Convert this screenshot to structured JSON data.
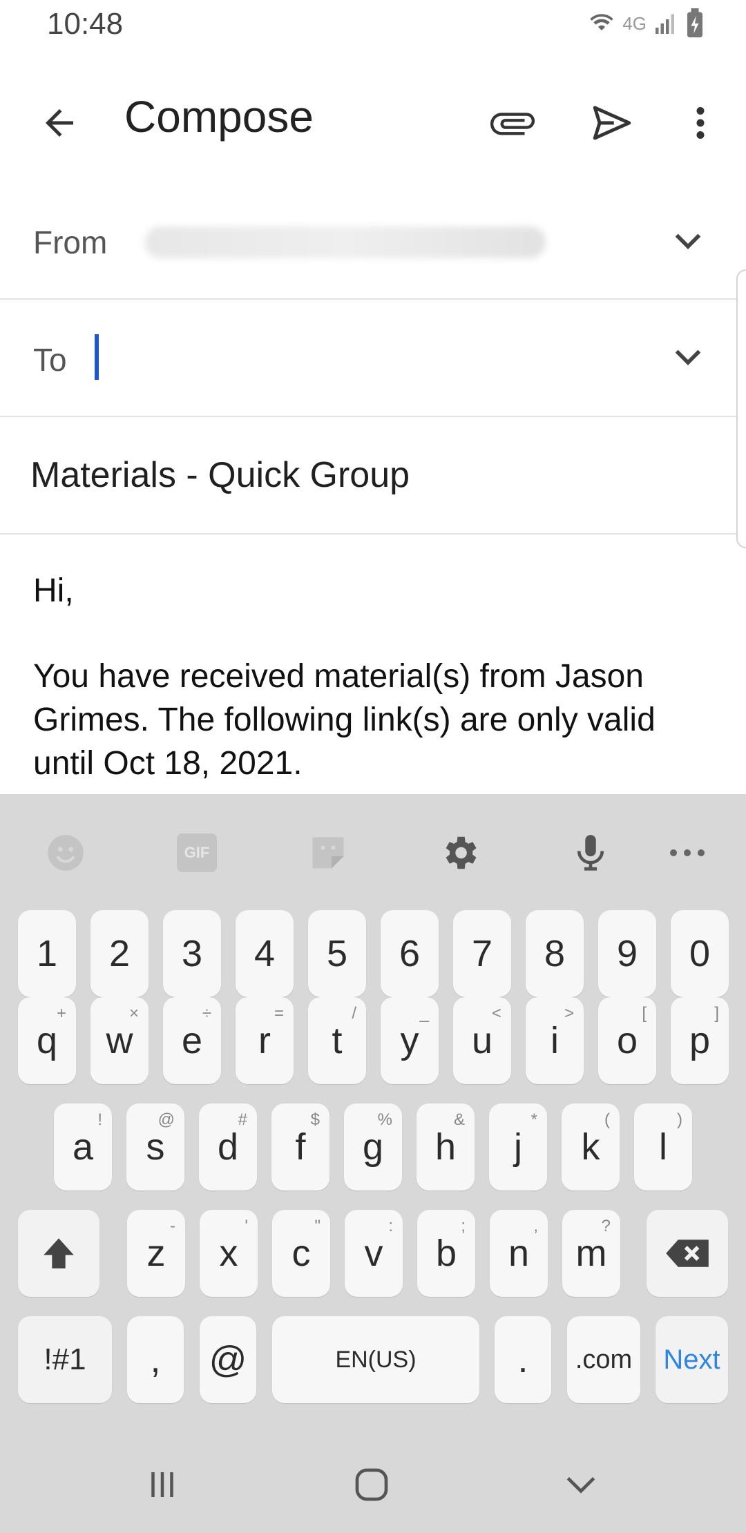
{
  "status_bar": {
    "time": "10:48",
    "network_label": "4G"
  },
  "app_bar": {
    "title": "Compose"
  },
  "compose": {
    "from_label": "From",
    "to_label": "To",
    "subject": "Materials - Quick Group",
    "body_greeting": "Hi,",
    "body_message": "You have received material(s) from Jason Grimes. The following link(s) are only valid until Oct 18, 2021."
  },
  "keyboard": {
    "number_row": [
      "1",
      "2",
      "3",
      "4",
      "5",
      "6",
      "7",
      "8",
      "9",
      "0"
    ],
    "row1": [
      {
        "k": "q",
        "h": "+"
      },
      {
        "k": "w",
        "h": "×"
      },
      {
        "k": "e",
        "h": "÷"
      },
      {
        "k": "r",
        "h": "="
      },
      {
        "k": "t",
        "h": "/"
      },
      {
        "k": "y",
        "h": "_"
      },
      {
        "k": "u",
        "h": "<"
      },
      {
        "k": "i",
        "h": ">"
      },
      {
        "k": "o",
        "h": "["
      },
      {
        "k": "p",
        "h": "]"
      }
    ],
    "row2": [
      {
        "k": "a",
        "h": "!"
      },
      {
        "k": "s",
        "h": "@"
      },
      {
        "k": "d",
        "h": "#"
      },
      {
        "k": "f",
        "h": "$"
      },
      {
        "k": "g",
        "h": "%"
      },
      {
        "k": "h",
        "h": "&"
      },
      {
        "k": "j",
        "h": "*"
      },
      {
        "k": "k",
        "h": "("
      },
      {
        "k": "l",
        "h": ")"
      }
    ],
    "row3": [
      {
        "k": "z",
        "h": "-"
      },
      {
        "k": "x",
        "h": "'"
      },
      {
        "k": "c",
        "h": "\""
      },
      {
        "k": "v",
        "h": ":"
      },
      {
        "k": "b",
        "h": ";"
      },
      {
        "k": "n",
        "h": ","
      },
      {
        "k": "m",
        "h": "?"
      }
    ],
    "symbols_label": "!#1",
    "comma_label": ",",
    "at_label": "@",
    "space_label": "EN(US)",
    "period_label": ".",
    "dotcom_label": ".com",
    "next_label": "Next",
    "gif_label": "GIF"
  },
  "colors": {
    "accent": "#1a55d6",
    "next": "#2f86e0",
    "keyboard_bg": "#d8d8d8"
  }
}
